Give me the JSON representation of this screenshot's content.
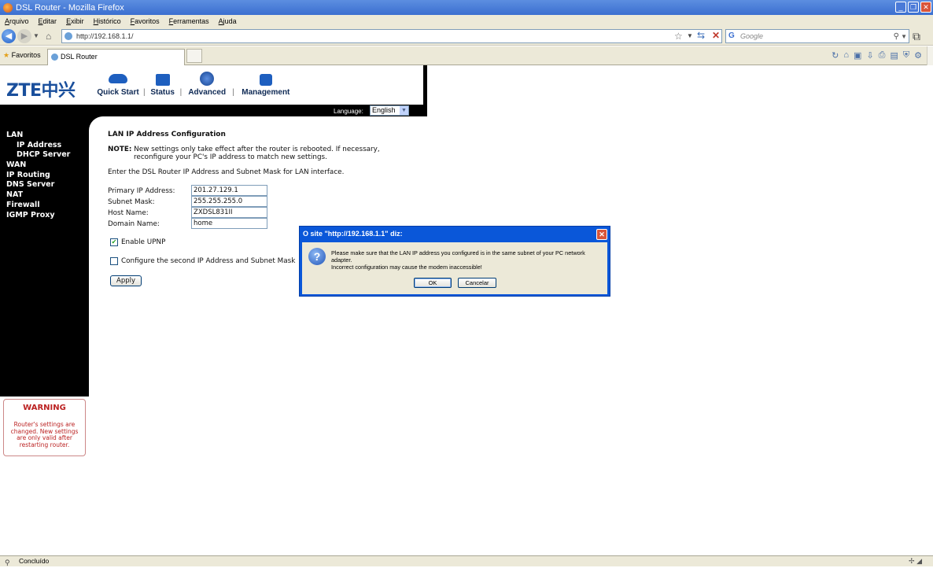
{
  "browser": {
    "window_title": "DSL Router - Mozilla Firefox",
    "menu": [
      "Arquivo",
      "Editar",
      "Exibir",
      "Histórico",
      "Favoritos",
      "Ferramentas",
      "Ajuda"
    ],
    "url": "http://192.168.1.1/",
    "search_placeholder": "Google",
    "bookmarks_label": "Favoritos",
    "tab_title": "DSL Router",
    "status_text": "Concluído"
  },
  "router": {
    "logo": "ZTE中兴",
    "nav": [
      "Quick Start",
      "Status",
      "Advanced",
      "Management"
    ],
    "language_label": "Language:",
    "language_value": "English",
    "sidebar": [
      {
        "label": "LAN",
        "sub": false
      },
      {
        "label": "IP Address",
        "sub": true
      },
      {
        "label": "DHCP Server",
        "sub": true
      },
      {
        "label": "WAN",
        "sub": false
      },
      {
        "label": "IP Routing",
        "sub": false
      },
      {
        "label": "DNS Server",
        "sub": false
      },
      {
        "label": "NAT",
        "sub": false
      },
      {
        "label": "Firewall",
        "sub": false
      },
      {
        "label": "IGMP Proxy",
        "sub": false
      }
    ],
    "warning": {
      "title": "WARNING",
      "body": "Router's settings are changed. New settings are only valid after restarting router."
    },
    "content": {
      "title": "LAN IP Address Configuration",
      "note_label": "NOTE:",
      "note_line1": "New settings only take effect after the router is rebooted. If necessary,",
      "note_line2": "reconfigure your PC's IP address to match new settings.",
      "enter_text": "Enter the DSL Router IP Address and Subnet Mask for LAN interface.",
      "fields": [
        {
          "label": "Primary IP Address:",
          "value": "201.27.129.1"
        },
        {
          "label": "Subnet Mask:",
          "value": "255.255.255.0"
        },
        {
          "label": "Host Name:",
          "value": "ZXDSL831II"
        },
        {
          "label": "Domain Name:",
          "value": "home"
        }
      ],
      "upnp_label": "Enable UPNP",
      "upnp_checked": true,
      "second_ip_label": "Configure the second IP Address and Subnet Mask",
      "second_ip_checked": false,
      "apply_label": "Apply"
    }
  },
  "dialog": {
    "title": "O site \"http://192.168.1.1\" diz:",
    "message_line1": "Please make sure that the LAN IP address you configured is in the same subnet of your PC network adapter.",
    "message_line2": "Incorrect configuration may cause the modem inaccessible!",
    "ok_label": "OK",
    "cancel_label": "Cancelar"
  }
}
